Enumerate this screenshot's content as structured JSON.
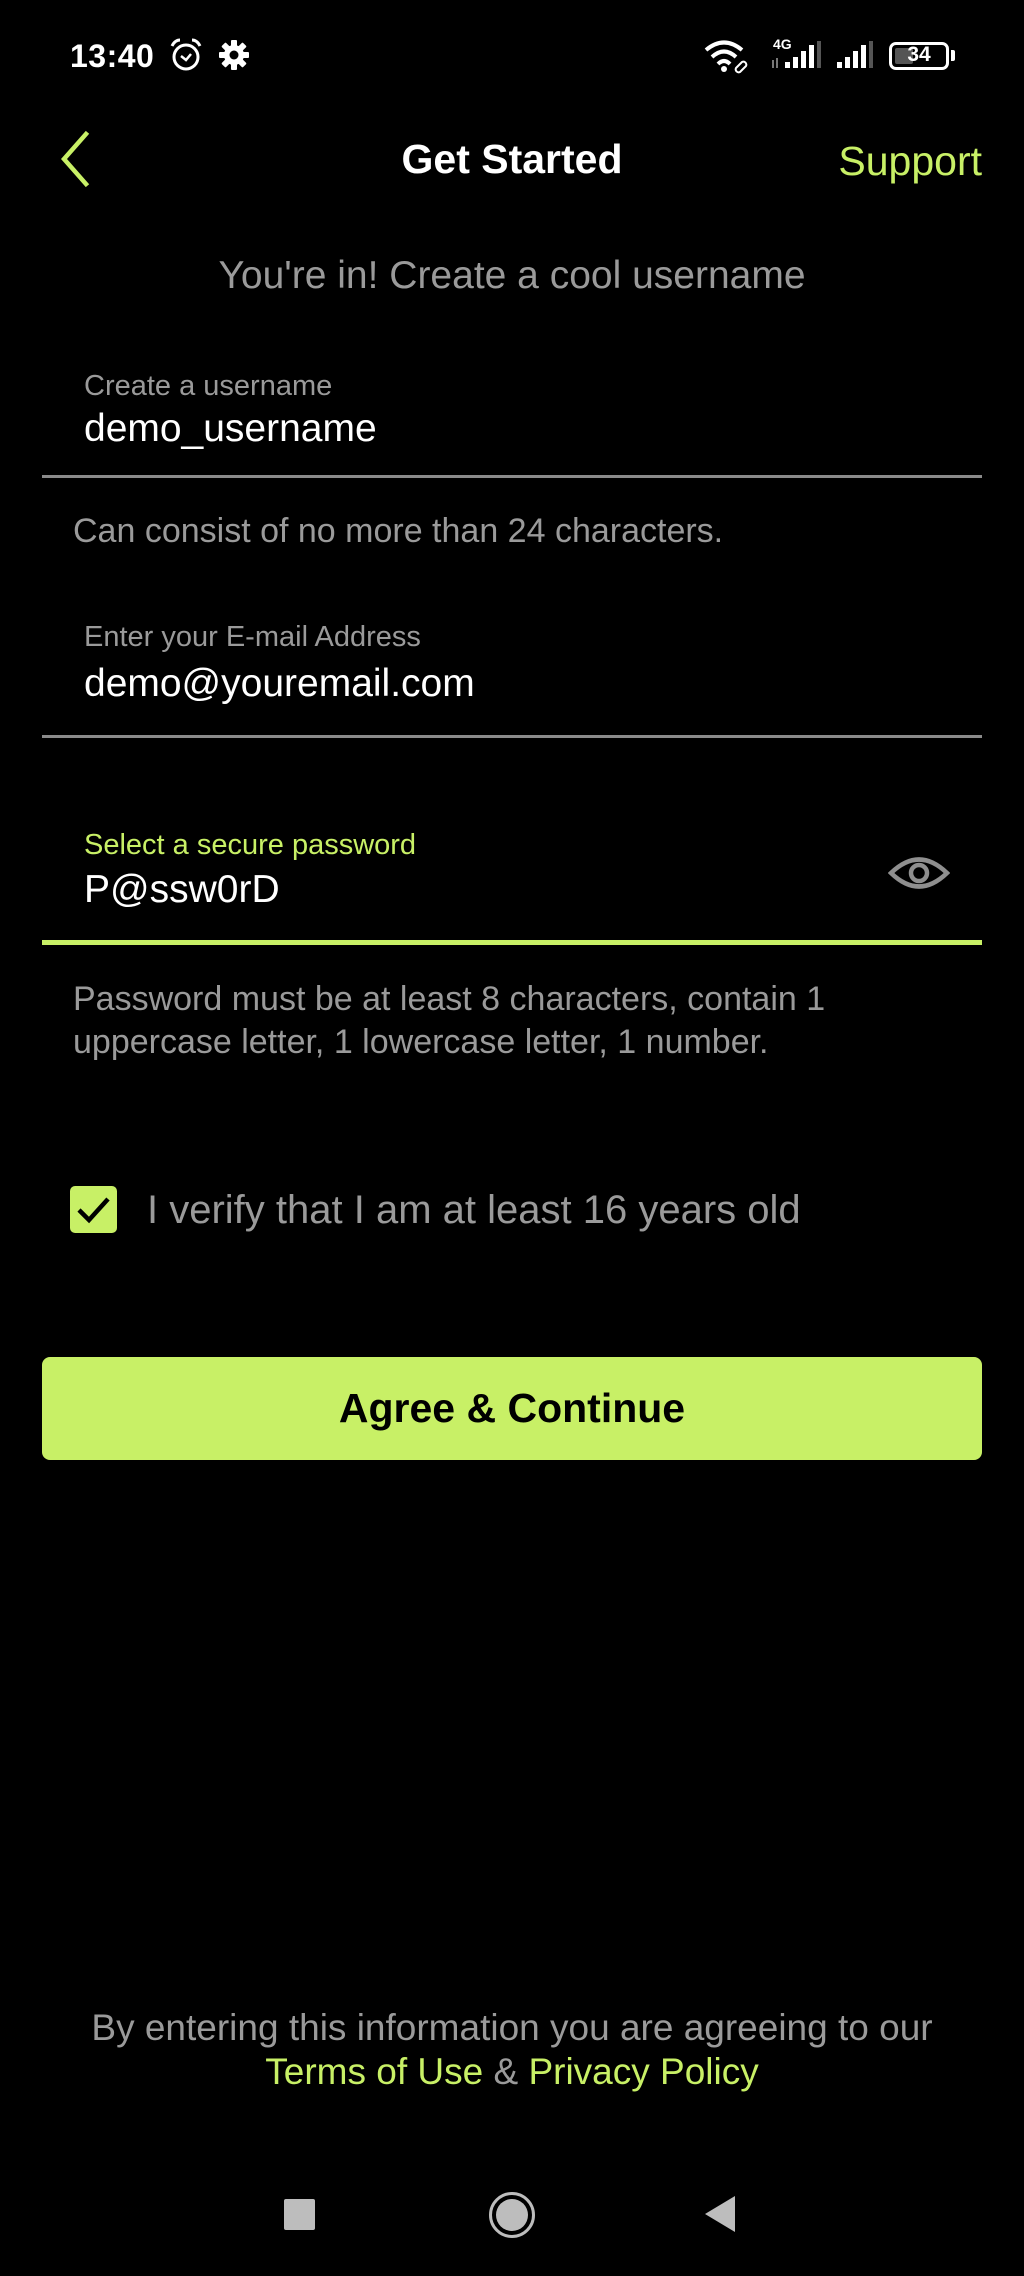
{
  "status_bar": {
    "time": "13:40",
    "icons": [
      "alarm-icon",
      "settings-gear-icon",
      "wifi-icon",
      "signal-4g-icon",
      "signal-icon",
      "battery-icon"
    ],
    "network_label": "4G",
    "battery_level": "34"
  },
  "header": {
    "back_icon": "chevron-left-icon",
    "title": "Get Started",
    "support_label": "Support"
  },
  "subtitle": "You're in! Create a cool username",
  "form": {
    "username": {
      "label": "Create a username",
      "value": "demo_username",
      "helper": "Can consist of no more than 24 characters."
    },
    "email": {
      "label": "Enter your E-mail Address",
      "value": "demo@youremail.com"
    },
    "password": {
      "label": "Select a secure password",
      "value": "P@ssw0rD",
      "toggle_icon": "eye-icon",
      "helper": "Password must be at least 8 characters, contain 1 uppercase letter, 1 lowercase letter, 1 number."
    },
    "age_check": {
      "checked": true,
      "label": "I verify that I am at least 16 years old"
    },
    "submit_label": "Agree & Continue"
  },
  "footer": {
    "text": "By entering this information you are agreeing to our",
    "terms_label": "Terms of Use",
    "separator": "&",
    "privacy_label": "Privacy Policy"
  },
  "nav_bar": {
    "icons": [
      "recents-square-icon",
      "home-circle-icon",
      "back-triangle-icon"
    ]
  },
  "colors": {
    "accent": "#c8f066",
    "background": "#000000",
    "muted_text": "#9a9a9a",
    "primary_text": "#ffffff"
  }
}
